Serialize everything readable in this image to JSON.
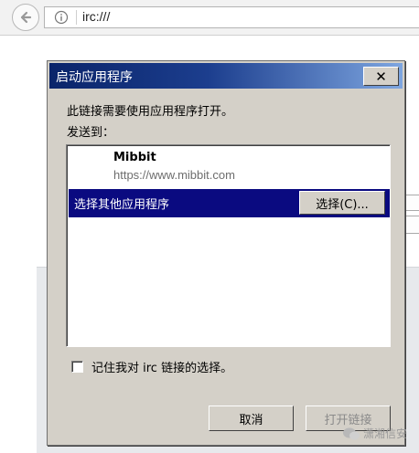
{
  "browser": {
    "url": "irc:///"
  },
  "dialog": {
    "title": "启动应用程序",
    "close_label": "✕",
    "message": "此链接需要使用应用程序打开。",
    "send_to_label": "发送到：",
    "app": {
      "name": "Mibbit",
      "url": "https://www.mibbit.com"
    },
    "choose_other_label": "选择其他应用程序",
    "choose_button_label": "选择(C)...",
    "remember_label": "记住我对 irc 链接的选择。",
    "remember_checked": false,
    "cancel_label": "取消",
    "open_link_label": "打开链接"
  },
  "watermark": {
    "text": "潇湘信安"
  },
  "colors": {
    "title_bar": "#0a246a",
    "selection": "#0a0a80",
    "dialog_face": "#d4d0c8"
  }
}
